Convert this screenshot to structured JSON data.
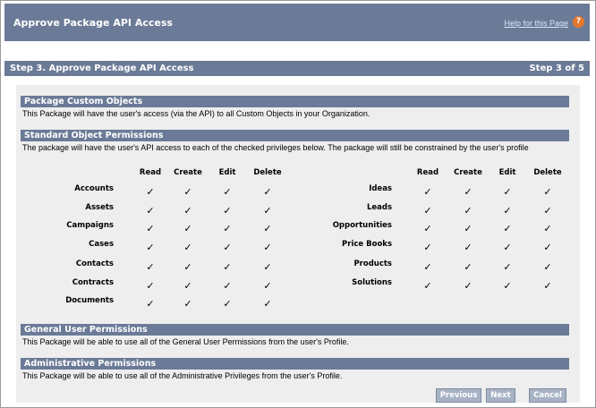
{
  "header": {
    "title": "Approve Package API Access",
    "help_link": "Help for this Page",
    "help_icon": "?"
  },
  "step": {
    "title": "Step 3. Approve Package API Access",
    "count": "Step 3 of 5"
  },
  "sections": {
    "custom": {
      "title": "Package Custom Objects",
      "text": "This Package will have the user's access (via the API) to all Custom Objects in your Organization."
    },
    "standard": {
      "title": "Standard Object Permissions",
      "text": "The package will have the user's API access to each of the checked privileges below. The package will still be constrained by the user's profile"
    },
    "general": {
      "title": "General User Permissions",
      "text": "This Package will be able to use all of the General User Permissions from the user's Profile."
    },
    "admin": {
      "title": "Administrative Permissions",
      "text": "This Package will be able to use all of the Administrative Privileges from the user's Profile."
    }
  },
  "columns": [
    "Read",
    "Create",
    "Edit",
    "Delete"
  ],
  "check_glyph": "✓",
  "left_objects": [
    "Accounts",
    "Assets",
    "Campaigns",
    "Cases",
    "Contacts",
    "Contracts",
    "Documents"
  ],
  "right_objects": [
    "Ideas",
    "Leads",
    "Opportunities",
    "Price Books",
    "Products",
    "Solutions"
  ],
  "buttons": {
    "previous": "Previous",
    "next": "Next",
    "cancel": "Cancel"
  }
}
